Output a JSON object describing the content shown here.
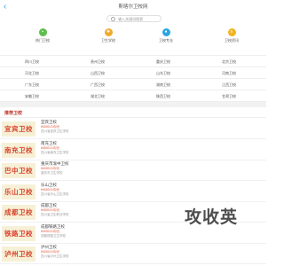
{
  "header": {
    "back_glyph": "‹",
    "title": "斯喀尔卫校网"
  },
  "search": {
    "placeholder": "输入关键词搜索"
  },
  "nav": [
    {
      "label": "热门卫校",
      "icon": "briefcase-icon",
      "color": "#5cbf4b"
    },
    {
      "label": "卫生学校",
      "icon": "hospital-icon",
      "color": "#f0a92a"
    },
    {
      "label": "卫校专业",
      "icon": "doctor-icon",
      "color": "#2aa6e0"
    },
    {
      "label": "卫校资讯",
      "icon": "news-icon",
      "color": "#f2b21f"
    }
  ],
  "regions": [
    [
      "四川卫校",
      "贵州卫校",
      "重庆卫校",
      "北京卫校"
    ],
    [
      "河北卫校",
      "山西卫校",
      "山东卫校",
      "河南卫校"
    ],
    [
      "广东卫校",
      "广西卫校",
      "湖南卫校",
      "江西卫校"
    ],
    [
      "安徽卫校",
      "湖北卫校",
      "陕西卫校",
      "甘肃卫校"
    ]
  ],
  "section": {
    "title": "推荐卫校"
  },
  "schools": [
    {
      "logo": "宜宾卫校",
      "logo_color": "#d6452c",
      "name": "宜宾卫校",
      "price": "¥4000人均/元",
      "desc": "四川省宜宾卫生学校"
    },
    {
      "logo": "南充卫校",
      "logo_color": "#d6452c",
      "name": "南充卫校",
      "price": "¥4500人均/元",
      "desc": "四川省南充卫生学校"
    },
    {
      "logo": "巴中卫校",
      "logo_color": "#d6452c",
      "name": "重庆市渝中卫校",
      "price": "¥4000人均/元",
      "desc": "重庆市卫生学校"
    },
    {
      "logo": "乐山卫校",
      "logo_color": "#d6452c",
      "name": "乐山卫校",
      "price": "¥4000人均/元",
      "desc": "四川省乐山卫生学校"
    },
    {
      "logo": "成都卫校",
      "logo_color": "#d6452c",
      "name": "成都卫校",
      "price": "¥4000人均/元",
      "desc": "四川省卫生职业学校"
    },
    {
      "logo": "铁路卫校",
      "logo_color": "#e03a2c",
      "name": "成都铁路卫校",
      "price": "¥4000人均/元",
      "desc": "成都铁路卫生学校"
    },
    {
      "logo": "泸州卫校",
      "logo_color": "#d6452c",
      "name": "泸州卫校",
      "price": "¥4000人均/元",
      "desc": "四川省泸州卫生学校"
    }
  ],
  "watermark": "攻收英"
}
